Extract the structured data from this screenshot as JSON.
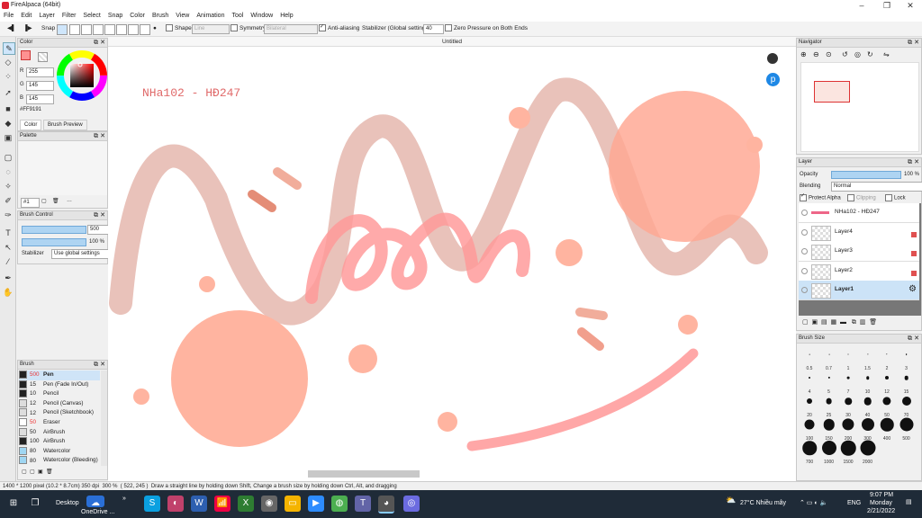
{
  "window": {
    "title": "FireAlpaca (64bit)",
    "doc_tab": "Untitled"
  },
  "menu": [
    "File",
    "Edit",
    "Layer",
    "Filter",
    "Select",
    "Snap",
    "Color",
    "Brush",
    "View",
    "Animation",
    "Tool",
    "Window",
    "Help"
  ],
  "toolbar": {
    "snap_label": "Snap",
    "shape_label": "Shape",
    "shape_value": "Line",
    "symmetry_label": "Symmetry",
    "symmetry_value": "Bilateral",
    "antialias_label": "Anti-aliasing",
    "stabilizer_label": "Stabilizer (Global settings)",
    "stabilizer_value": "40",
    "zero_pressure_label": "Zero Pressure on Both Ends"
  },
  "color_panel": {
    "title": "Color",
    "r_label": "R",
    "r": "255",
    "g_label": "G",
    "g": "145",
    "b_label": "B",
    "b": "145",
    "hex": "#FF9191",
    "current_color": "#ff9191",
    "tabs": [
      "Color",
      "Brush Preview"
    ]
  },
  "palette_panel": {
    "title": "Palette",
    "number": "#1"
  },
  "brush_control": {
    "title": "Brush Control",
    "size": "500",
    "opacity": "100 %",
    "opacity_fraction": 1.0,
    "stabilizer_label": "Stabilizer",
    "stabilizer_value": "Use global settings"
  },
  "brush_panel": {
    "title": "Brush",
    "items": [
      {
        "size": "500",
        "name": "Pen",
        "color": "#222"
      },
      {
        "size": "15",
        "name": "Pen (Fade In/Out)",
        "color": "#222"
      },
      {
        "size": "10",
        "name": "Pencil",
        "color": "#222"
      },
      {
        "size": "12",
        "name": "Pencil (Canvas)",
        "color": "#ddd"
      },
      {
        "size": "12",
        "name": "Pencil (Sketchbook)",
        "color": "#ddd"
      },
      {
        "size": "50",
        "name": "Eraser",
        "color": "#fff"
      },
      {
        "size": "50",
        "name": "AirBrush",
        "color": "#ddd"
      },
      {
        "size": "100",
        "name": "AirBrush",
        "color": "#222"
      },
      {
        "size": "80",
        "name": "Watercolor",
        "color": "#9fd6f2"
      },
      {
        "size": "80",
        "name": "Watercolor (Bleeding)",
        "color": "#9fd6f2"
      }
    ]
  },
  "canvas": {
    "text": "NHa102 - HĐ247"
  },
  "navigator": {
    "title": "Navigator"
  },
  "layer_panel": {
    "title": "Layer",
    "opacity_label": "Opacity",
    "opacity_value": "100 %",
    "opacity_fraction": 1.0,
    "blending_label": "Blending",
    "blending_value": "Normal",
    "protect_alpha": "Protect Alpha",
    "clipping": "Clipping",
    "lock": "Lock",
    "layers": [
      {
        "name": "NHa102 - HĐ247"
      },
      {
        "name": "Layer4"
      },
      {
        "name": "Layer3"
      },
      {
        "name": "Layer2"
      },
      {
        "name": "Layer1"
      }
    ]
  },
  "brush_size_panel": {
    "title": "Brush Size",
    "sizes": [
      "0.5",
      "0.7",
      "1",
      "1.5",
      "2",
      "3",
      "4",
      "5",
      "7",
      "10",
      "12",
      "15",
      "20",
      "25",
      "30",
      "40",
      "50",
      "70",
      "100",
      "150",
      "200",
      "300",
      "400",
      "500",
      "700",
      "1000",
      "1500",
      "2000"
    ]
  },
  "status": {
    "dimensions": "1400 * 1200 pixel",
    "physical": "(10.2 * 8.7cm)",
    "dpi": "350 dpi",
    "zoom": "300 %",
    "coords": "( 522, 245 )",
    "hint": "Draw a straight line by holding down Shift, Change a brush size by holding down Ctrl, Alt, and dragging"
  },
  "taskbar": {
    "desktop": "Desktop",
    "onedrive": "OneDrive ...",
    "weather": "27°C  Nhiều mây",
    "lang": "ENG",
    "time": "9:07 PM",
    "day": "Monday",
    "date": "2/21/2022"
  }
}
